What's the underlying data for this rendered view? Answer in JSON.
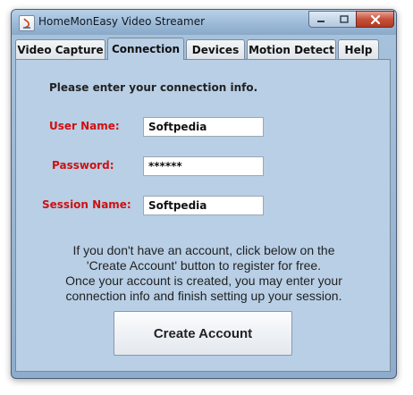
{
  "window": {
    "title": "HomeMonEasy Video Streamer"
  },
  "tabs": [
    {
      "label": "Video Capture"
    },
    {
      "label": "Connection"
    },
    {
      "label": "Devices"
    },
    {
      "label": "Motion Detect"
    },
    {
      "label": "Help"
    }
  ],
  "active_tab": "Connection",
  "connection": {
    "intro": "Please enter your connection info.",
    "username_label": "User Name:",
    "username_value": "Softpedia",
    "password_label": "Password:",
    "password_value": "******",
    "session_label": "Session Name:",
    "session_value": "Softpedia",
    "info_lines": [
      "If you don't have an account, click below on the",
      "'Create Account' button to register for free.",
      "Once your account is created, you may enter your",
      "connection info and finish setting up your session."
    ],
    "create_button": "Create Account"
  },
  "colors": {
    "panel": "#b8cfe6",
    "label_red": "#d01010",
    "close_button": "#c7503a"
  },
  "icons": [
    "app-icon",
    "minimize-icon",
    "maximize-icon",
    "close-icon"
  ]
}
